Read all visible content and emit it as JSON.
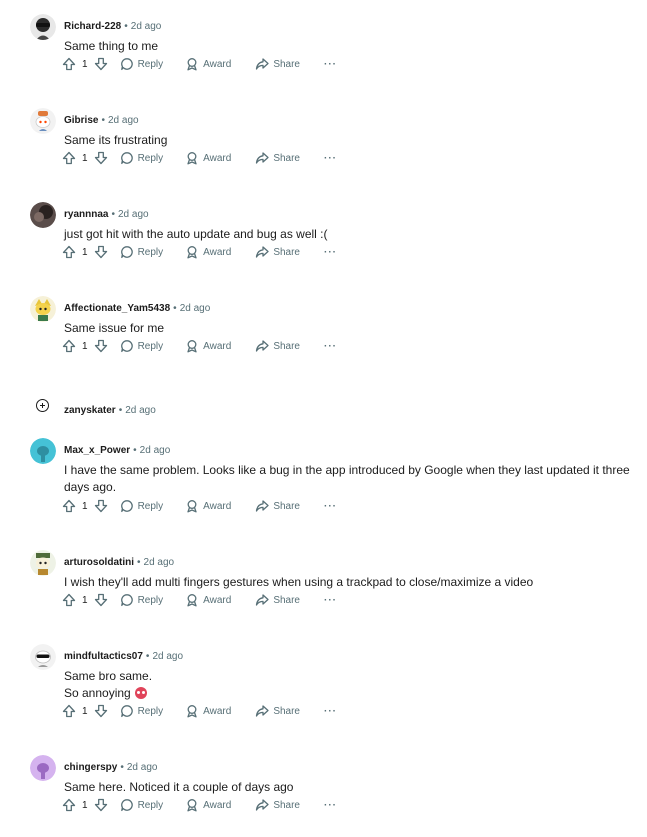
{
  "thread": {
    "comments": [
      {
        "author": "Richard-228",
        "time": "2d ago",
        "lines": [
          "Same thing to me"
        ],
        "votes": "1",
        "avatar": "avatar-sunglasses-dark"
      },
      {
        "author": "Gibrise",
        "time": "2d ago",
        "lines": [
          "Same its frustrating"
        ],
        "votes": "1",
        "avatar": "avatar-snoo-hat"
      },
      {
        "author": "ryannnaa",
        "time": "2d ago",
        "lines": [
          "just got hit with the auto update and bug as well :("
        ],
        "votes": "1",
        "avatar": "avatar-photo-dark"
      },
      {
        "author": "Affectionate_Yam5438",
        "time": "2d ago",
        "lines": [
          "Same issue for me"
        ],
        "votes": "1",
        "avatar": "avatar-snoo-yellow"
      },
      {
        "author": "zanyskater",
        "time": "2d ago",
        "lines": [],
        "votes": "",
        "avatar": "expand-icon",
        "collapsed": true
      },
      {
        "author": "Max_x_Power",
        "time": "2d ago",
        "lines": [
          "I have the same problem. Looks like a bug in the app introduced by Google when they last updated it three days ago."
        ],
        "votes": "1",
        "avatar": "avatar-snoo-teal"
      },
      {
        "author": "arturosoldatini",
        "time": "2d ago",
        "lines": [
          "I wish they'll add multi fingers gestures when using a trackpad to close/maximize a video"
        ],
        "votes": "1",
        "avatar": "avatar-snoo-green"
      },
      {
        "author": "mindfultactics07",
        "time": "2d ago",
        "lines": [
          "Same bro same.",
          "So annoying"
        ],
        "emoji": "red-face-emoji",
        "votes": "1",
        "avatar": "avatar-snoo-sunglasses"
      },
      {
        "author": "chingerspy",
        "time": "2d ago",
        "lines": [
          "Same here. Noticed it a couple of days ago"
        ],
        "votes": "1",
        "avatar": "avatar-snoo-purple"
      }
    ],
    "labels": {
      "separator": "•",
      "reply": "Reply",
      "award": "Award",
      "share": "Share",
      "more": "···"
    }
  },
  "colors": {
    "text": "#1c1c1c",
    "meta": "#576f76",
    "icon": "#576f76",
    "emoji": "#e0445a"
  }
}
